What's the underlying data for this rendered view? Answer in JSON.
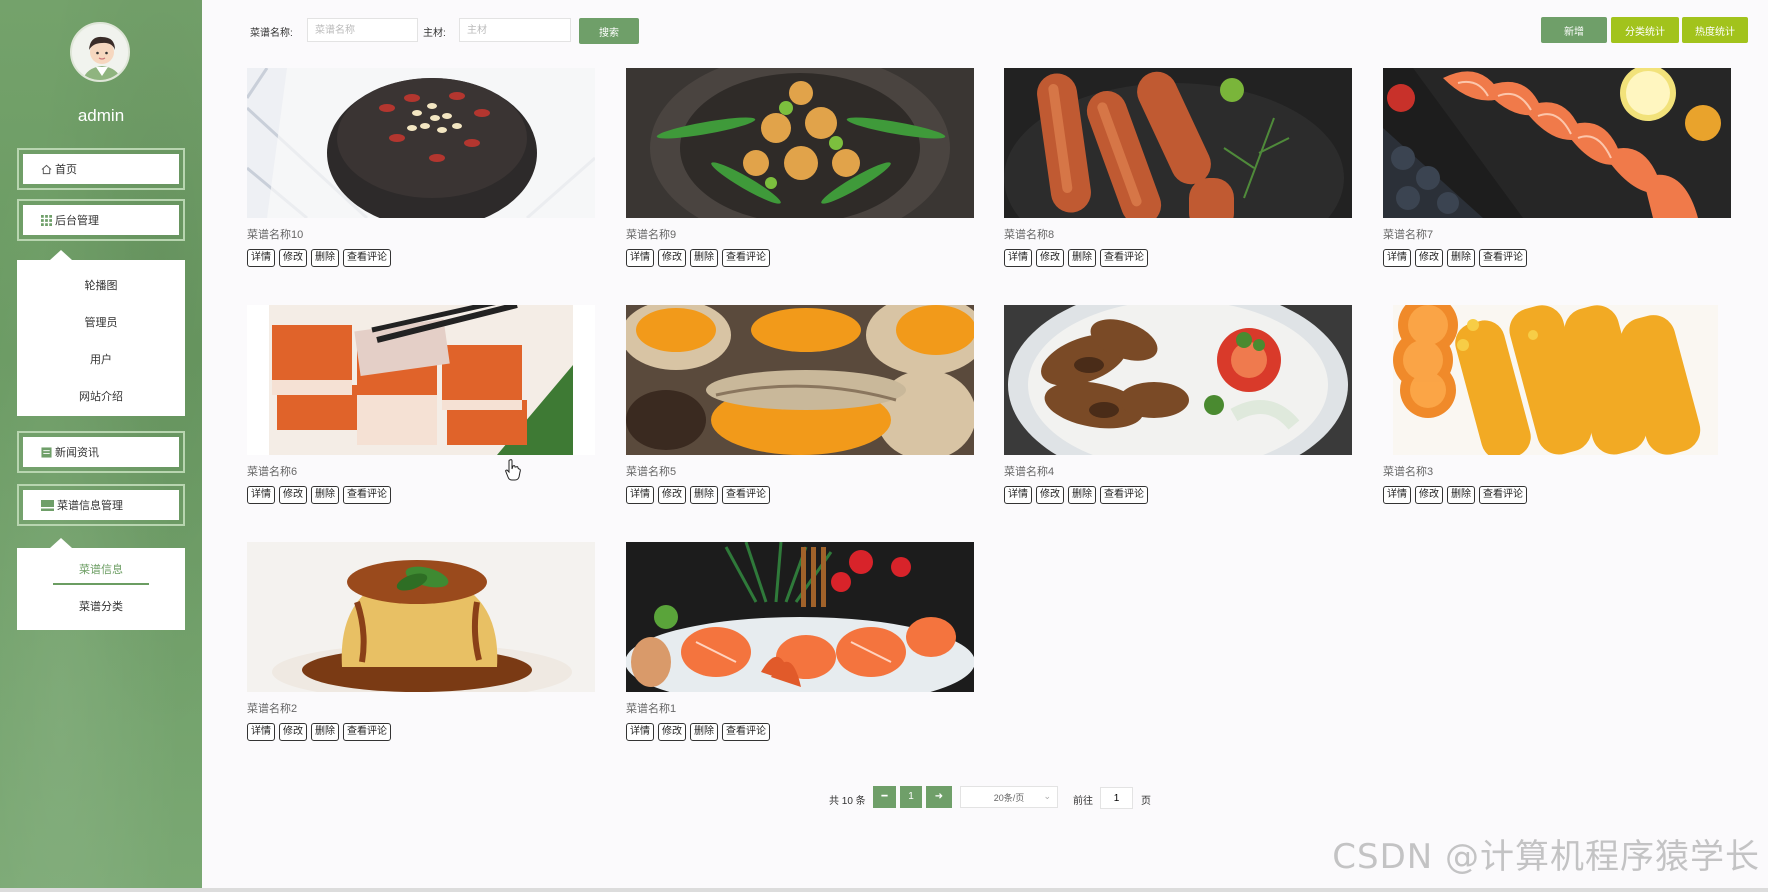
{
  "user": {
    "name": "admin"
  },
  "sidebar": {
    "home": "首页",
    "backend": "后台管理",
    "backend_items": [
      "轮播图",
      "管理员",
      "用户",
      "网站介绍"
    ],
    "news": "新闻资讯",
    "recipe_mgmt": "菜谱信息管理",
    "recipe_items": [
      "菜谱信息",
      "菜谱分类"
    ]
  },
  "search": {
    "name_label": "菜谱名称:",
    "name_placeholder": "菜谱名称",
    "ingredient_label": "主材:",
    "ingredient_placeholder": "主材",
    "search_button": "搜索"
  },
  "toolbar": {
    "add": "新增",
    "category_stats": "分类统计",
    "popularity_stats": "热度统计"
  },
  "card_actions": [
    "详情",
    "修改",
    "删除",
    "查看评论"
  ],
  "recipes": [
    {
      "name": "菜谱名称10"
    },
    {
      "name": "菜谱名称9"
    },
    {
      "name": "菜谱名称8"
    },
    {
      "name": "菜谱名称7"
    },
    {
      "name": "菜谱名称6"
    },
    {
      "name": "菜谱名称5"
    },
    {
      "name": "菜谱名称4"
    },
    {
      "name": "菜谱名称3"
    },
    {
      "name": "菜谱名称2"
    },
    {
      "name": "菜谱名称1"
    }
  ],
  "pagination": {
    "total": "共 10 条",
    "current_page": "1",
    "page_size": "20条/页",
    "goto_label": "前往",
    "goto_value": "1",
    "page_suffix": "页"
  },
  "watermark": "CSDN @计算机程序猿学长",
  "colors": {
    "primary": "#6f9f69",
    "accent": "#a2c31c",
    "sidebar": "#6a9a62"
  }
}
